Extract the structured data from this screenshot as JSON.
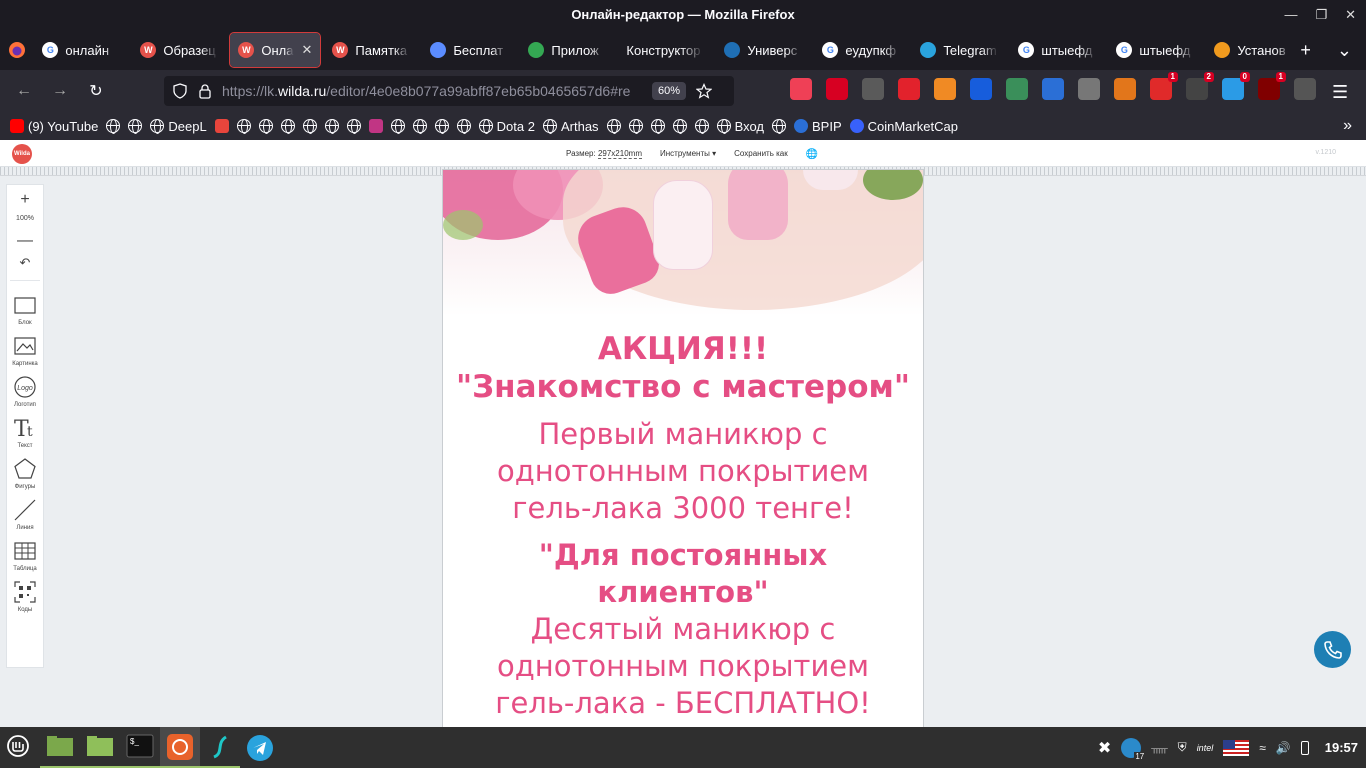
{
  "window": {
    "title": "Онлайн-редактор — Mozilla Firefox"
  },
  "tabs": [
    {
      "label": "онлайн",
      "icon": "google-icon",
      "color": "#ffffff",
      "active": false
    },
    {
      "label": "Образец",
      "icon": "wilda-icon",
      "color": "#e5524b",
      "active": false
    },
    {
      "label": "Онлайн",
      "icon": "wilda-icon",
      "color": "#e5524b",
      "active": true
    },
    {
      "label": "Памятка",
      "icon": "wilda-icon",
      "color": "#e5524b",
      "active": false
    },
    {
      "label": "Бесплат",
      "icon": "pen-icon",
      "color": "#5b8cff",
      "active": false
    },
    {
      "label": "Прилож",
      "icon": "play-store-icon",
      "color": "#34a853",
      "active": false
    },
    {
      "label": "Конструктор",
      "icon": "none",
      "color": "#1c1b22",
      "active": false
    },
    {
      "label": "Универс",
      "icon": "kp10-icon",
      "color": "#1f6fb5",
      "active": false
    },
    {
      "label": "еудупкф",
      "icon": "google-icon",
      "color": "#ffffff",
      "active": false
    },
    {
      "label": "Telegram",
      "icon": "telegram-icon",
      "color": "#2aa3dd",
      "active": false
    },
    {
      "label": "штыефд",
      "icon": "google-icon",
      "color": "#ffffff",
      "active": false
    },
    {
      "label": "штыефд",
      "icon": "google-icon",
      "color": "#ffffff",
      "active": false
    },
    {
      "label": "Установ",
      "icon": "lt-icon",
      "color": "#f09a1e",
      "active": false
    }
  ],
  "navbar": {
    "url_prefix": "https://lk.",
    "url_host": "wilda.ru",
    "url_path": "/editor/4e0e8b077a99abff87eb65b0465657d6#re",
    "zoom": "60%"
  },
  "extensions": [
    {
      "name": "pocket-icon",
      "color": "#ef4056",
      "badge": ""
    },
    {
      "name": "download-icon",
      "color": "#d70022",
      "badge": ""
    },
    {
      "name": "c-extension-icon",
      "color": "#5a5a5a",
      "badge": ""
    },
    {
      "name": "s-extension-icon",
      "color": "#e2222c",
      "badge": ""
    },
    {
      "name": "trash-icon",
      "color": "#f08a24",
      "badge": ""
    },
    {
      "name": "bitwarden-icon",
      "color": "#175ddc",
      "badge": ""
    },
    {
      "name": "globe-green-icon",
      "color": "#3a8f5a",
      "badge": ""
    },
    {
      "name": "info-icon",
      "color": "#2b6fd6",
      "badge": ""
    },
    {
      "name": "cat-icon",
      "color": "#777777",
      "badge": ""
    },
    {
      "name": "metamask-icon",
      "color": "#e2761b",
      "badge": ""
    },
    {
      "name": "timer-icon",
      "color": "#e02a2a",
      "badge": "1"
    },
    {
      "name": "mask-icon",
      "color": "#444444",
      "badge": "2"
    },
    {
      "name": "blue-square-icon",
      "color": "#2b9be6",
      "badge": "0"
    },
    {
      "name": "ublock-icon",
      "color": "#800000",
      "badge": "1"
    },
    {
      "name": "cs-icon",
      "color": "#555555",
      "badge": ""
    }
  ],
  "bookmarks": [
    {
      "label": "(9) YouTube",
      "icon": "youtube-icon"
    },
    {
      "label": "",
      "icon": "globe-icon"
    },
    {
      "label": "",
      "icon": "globe-icon"
    },
    {
      "label": "DeepL",
      "icon": "globe-icon"
    },
    {
      "label": "",
      "icon": "translate-icon"
    },
    {
      "label": "",
      "icon": "globe-icon"
    },
    {
      "label": "",
      "icon": "globe-icon"
    },
    {
      "label": "",
      "icon": "globe-icon"
    },
    {
      "label": "",
      "icon": "globe-icon"
    },
    {
      "label": "",
      "icon": "globe-icon"
    },
    {
      "label": "",
      "icon": "globe-icon"
    },
    {
      "label": "",
      "icon": "instagram-icon"
    },
    {
      "label": "",
      "icon": "globe-icon"
    },
    {
      "label": "",
      "icon": "globe-icon"
    },
    {
      "label": "",
      "icon": "globe-icon"
    },
    {
      "label": "",
      "icon": "globe-icon"
    },
    {
      "label": "Dota 2",
      "icon": "globe-icon"
    },
    {
      "label": "Arthas",
      "icon": "globe-icon"
    },
    {
      "label": "",
      "icon": "globe-icon"
    },
    {
      "label": "",
      "icon": "globe-icon"
    },
    {
      "label": "",
      "icon": "globe-icon"
    },
    {
      "label": "",
      "icon": "globe-icon"
    },
    {
      "label": "",
      "icon": "globe-icon"
    },
    {
      "label": "Вход",
      "icon": "globe-icon"
    },
    {
      "label": "",
      "icon": "globe-icon"
    },
    {
      "label": "BPIP",
      "icon": "info-icon"
    },
    {
      "label": "CoinMarketCap",
      "icon": "coinmarketcap-icon"
    }
  ],
  "editor": {
    "logo": "Wilda",
    "size_label": "Размер:",
    "size_value": "297x210mm",
    "tools_menu": "Инструменты ▾",
    "save_as": "Сохранить как",
    "version": "v.1210",
    "zoom_level": "100%",
    "tools": [
      {
        "label": "Блок",
        "icon": "block-icon"
      },
      {
        "label": "Картинка",
        "icon": "image-icon"
      },
      {
        "label": "Логотип",
        "icon": "logo-icon"
      },
      {
        "label": "Текст",
        "icon": "text-icon"
      },
      {
        "label": "Фигуры",
        "icon": "pentagon-icon"
      },
      {
        "label": "Линия",
        "icon": "line-icon"
      },
      {
        "label": "Таблица",
        "icon": "table-icon"
      },
      {
        "label": "Коды",
        "icon": "qr-code-icon"
      }
    ]
  },
  "poster": {
    "headline1": "АКЦИЯ!!!",
    "headline2": "\"Знакомство с мастером\"",
    "offer1_line1": "Первый маникюр с",
    "offer1_line2": "однотонным покрытием",
    "offer1_line3": "гель-лака 3000 тенге!",
    "headline3_line1": "\"Для постоянных",
    "headline3_line2": "клиентов\"",
    "offer2_line1": "Десятый маникюр с",
    "offer2_line2": "однотонным покрытием",
    "offer2_line3": "гель-лака - БЕСПЛАТНО!",
    "text_color": "#e54e84"
  },
  "taskbar": {
    "apps": [
      {
        "name": "mint-menu-icon",
        "running": false,
        "active": false
      },
      {
        "name": "files-icon",
        "running": true,
        "active": false
      },
      {
        "name": "folder-icon",
        "running": true,
        "active": false
      },
      {
        "name": "terminal-icon",
        "running": true,
        "active": false
      },
      {
        "name": "firefox-icon",
        "running": true,
        "active": true
      },
      {
        "name": "surfshark-icon",
        "running": true,
        "active": false
      },
      {
        "name": "telegram-icon",
        "running": false,
        "active": false
      }
    ],
    "tray": {
      "update_count": "17",
      "clock": "19:57"
    }
  }
}
